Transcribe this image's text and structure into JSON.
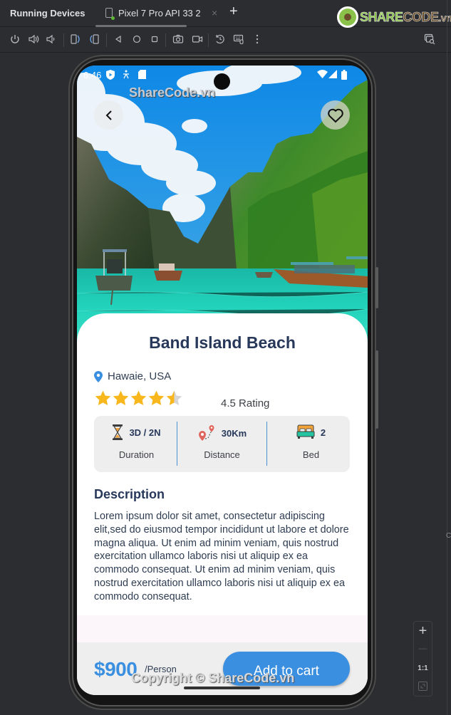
{
  "ide": {
    "panel_title": "Running Devices",
    "device_tab_label": "Pixel 7 Pro API 33 2",
    "close_tab": "×",
    "add_tab": "+",
    "logo": {
      "green": "SHARE",
      "brown": "CODE",
      "suffix": ".vn"
    },
    "toolbar_icons": [
      "power-icon",
      "volume-up-icon",
      "volume-down-icon",
      "rotate-left-icon",
      "rotate-right-icon",
      "back-icon",
      "home-icon",
      "overview-icon",
      "screenshot-icon",
      "screen-record-icon",
      "reset-icon",
      "keyboard-icon",
      "more-icon",
      "device-mirroring-icon"
    ],
    "zoom_controls": {
      "zoom_in": "+",
      "zoom_out": "—",
      "actual_size": "1:1"
    }
  },
  "status_bar": {
    "time": "6:46"
  },
  "watermarks": {
    "top": "ShareCode.vn",
    "bottom": "Copyright © ShareCode.vn"
  },
  "detail": {
    "title": "Band Island Beach",
    "location": "Hawaie, USA",
    "rating_value": 4.5,
    "rating_max": 5,
    "rating_label": "4.5 Rating",
    "stats": [
      {
        "icon": "hourglass-icon",
        "value": "3D / 2N",
        "label": "Duration"
      },
      {
        "icon": "route-pin-icon",
        "value": "30Km",
        "label": "Distance"
      },
      {
        "icon": "bed-icon",
        "value": "2",
        "label": "Bed"
      }
    ],
    "description_heading": "Description",
    "description": "Lorem ipsum dolor sit amet, consectetur adipiscing  elit,sed do eiusmod tempor incididunt ut labore et  dolore magna aliqua. Ut enim ad minim veniam, quis  nostrud exercitation ullamco laboris nisi ut aliquip  ex ea commodo consequat. Ut enim ad minim  veniam, quis nostrud exercitation ullamco laboris  nisi ut aliquip ex ea commodo consequat."
  },
  "footer": {
    "price": "$900",
    "per_unit": "/Person",
    "cta": "Add to cart"
  },
  "colors": {
    "accent": "#3b8fe0",
    "title": "#27385a",
    "star": "#f8b81d",
    "ide_bg": "#2b2d30"
  }
}
